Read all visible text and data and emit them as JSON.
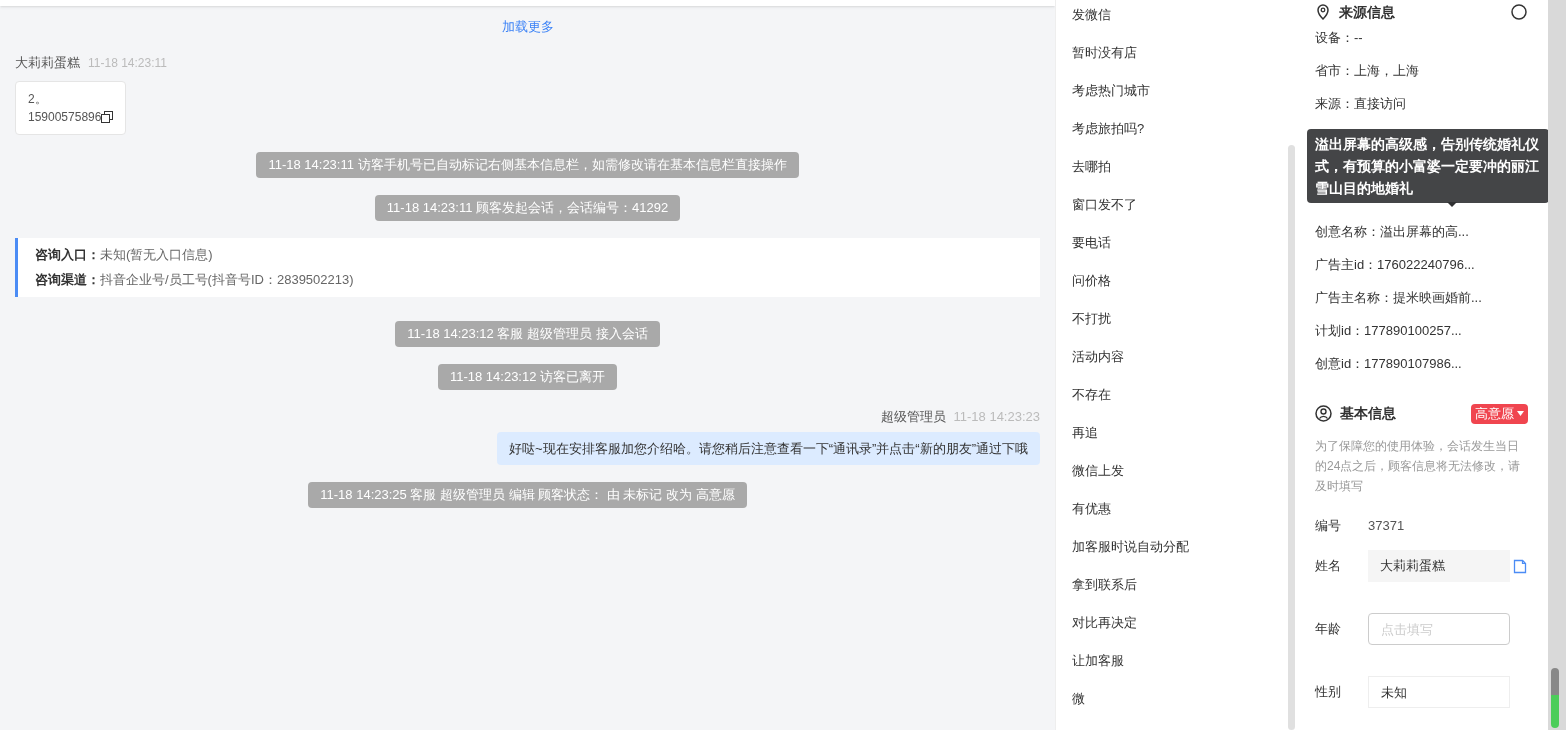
{
  "chat": {
    "load_more": "加载更多",
    "messages": [
      {
        "kind": "customer",
        "sender": "大莉莉蛋糕",
        "time": "11-18 14:23:11",
        "lines": [
          "2。",
          "15900575896"
        ]
      },
      {
        "kind": "system",
        "text": "11-18 14:23:11 访客手机号已自动标记右侧基本信息栏，如需修改请在基本信息栏直接操作"
      },
      {
        "kind": "system",
        "text": "11-18 14:23:11 顾客发起会话，会话编号：41292"
      },
      {
        "kind": "info",
        "rows": [
          {
            "label": "咨询入口：",
            "value": "未知(暂无入口信息)"
          },
          {
            "label": "咨询渠道：",
            "value": "抖音企业号/员工号(抖音号ID：2839502213)"
          }
        ]
      },
      {
        "kind": "system",
        "text": "11-18 14:23:12 客服 超级管理员 接入会话"
      },
      {
        "kind": "system",
        "text": "11-18 14:23:12 访客已离开"
      },
      {
        "kind": "agent",
        "sender": "超级管理员",
        "time": "11-18 14:23:23",
        "text": "好哒~现在安排客服加您介绍哈。请您稍后注意查看一下“通讯录”并点击“新的朋友”通过下哦"
      },
      {
        "kind": "system",
        "text": "11-18 14:23:25 客服 超级管理员 编辑 顾客状态： 由 未标记 改为 高意愿"
      }
    ]
  },
  "quick_replies": [
    "发微信",
    "暂时没有店",
    "考虑热门城市",
    "考虑旅拍吗?",
    "去哪拍",
    "窗口发不了",
    "要电话",
    "问价格",
    "不打扰",
    "活动内容",
    "不存在",
    "再追",
    "微信上发",
    "有优惠",
    "加客服时说自动分配",
    "拿到联系后",
    "对比再决定",
    "让加客服",
    "微"
  ],
  "source_info": {
    "title": "来源信息",
    "rows_top": [
      "设备：--",
      "省市：上海，上海",
      "来源：直接访问"
    ],
    "tooltip": "溢出屏幕的高级感，告别传统婚礼仪式，有预算的小富婆一定要冲的丽江雪山目的地婚礼",
    "rows_bottom": [
      "创意名称：溢出屏幕的高...",
      "广告主id：176022240796...",
      "广告主名称：提米映画婚前...",
      "计划id：177890100257...",
      "创意id：177890107986..."
    ]
  },
  "basic_info": {
    "title": "基本信息",
    "intent": "高意愿",
    "notice": "为了保障您的使用体验，会话发生当日的24点之后，顾客信息将无法修改，请及时填写",
    "fields": [
      {
        "kind": "text",
        "label": "编号",
        "value": "37371"
      },
      {
        "kind": "filled",
        "label": "姓名",
        "value": "大莉莉蛋糕"
      },
      {
        "kind": "input",
        "label": "年龄",
        "placeholder": "点击填写"
      },
      {
        "kind": "select",
        "label": "性别",
        "value": "未知"
      }
    ]
  }
}
